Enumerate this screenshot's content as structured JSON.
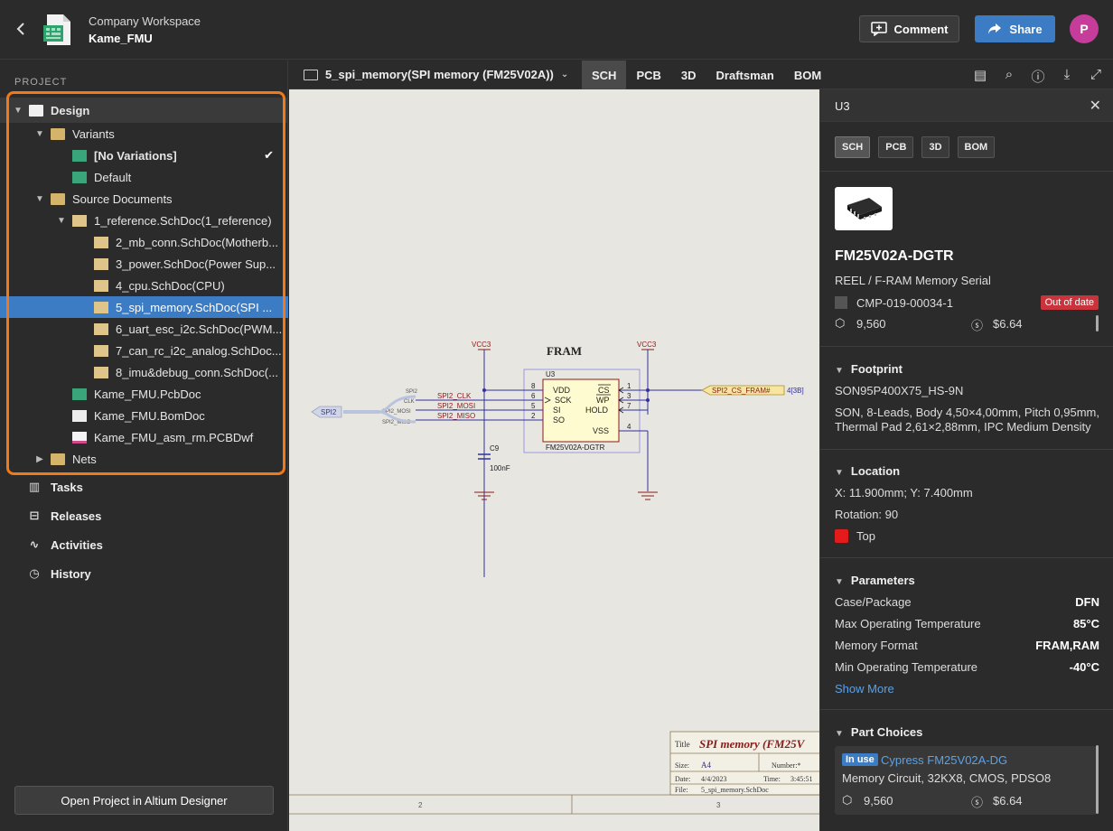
{
  "header": {
    "workspace": "Company Workspace",
    "project": "Kame_FMU",
    "comment_label": "Comment",
    "share_label": "Share",
    "avatar_initial": "P"
  },
  "sidebar": {
    "section_label": "PROJECT",
    "tree": {
      "design": "Design",
      "variants": "Variants",
      "no_variations": "[No Variations]",
      "default": "Default",
      "source_documents": "Source Documents",
      "ref_doc": "1_reference.SchDoc(1_reference)",
      "docs": [
        "2_mb_conn.SchDoc(Motherb...",
        "3_power.SchDoc(Power Sup...",
        "4_cpu.SchDoc(CPU)",
        "5_spi_memory.SchDoc(SPI ...",
        "6_uart_esc_i2c.SchDoc(PWM...",
        "7_can_rc_i2c_analog.SchDoc...",
        "8_imu&debug_conn.SchDoc(..."
      ],
      "pcbdoc": "Kame_FMU.PcbDoc",
      "bomdoc": "Kame_FMU.BomDoc",
      "pcbdwf": "Kame_FMU_asm_rm.PCBDwf",
      "nets": "Nets"
    },
    "nav": {
      "tasks": "Tasks",
      "releases": "Releases",
      "activities": "Activities",
      "history": "History"
    },
    "open_button": "Open Project in Altium Designer"
  },
  "docbar": {
    "document": "5_spi_memory(SPI memory (FM25V02A))",
    "tabs": [
      "SCH",
      "PCB",
      "3D",
      "Draftsman",
      "BOM"
    ],
    "active_tab": "SCH"
  },
  "schematic": {
    "block_title": "FRAM",
    "designator": "U3",
    "part": "FM25V02A-DGTR",
    "vcc_left": "VCC3",
    "vcc_right": "VCC3",
    "pins_left": [
      {
        "num": "8",
        "name": "VDD"
      },
      {
        "num": "6",
        "name": "SCK"
      },
      {
        "num": "5",
        "name": "SI"
      },
      {
        "num": "2",
        "name": "SO"
      }
    ],
    "pins_right": [
      {
        "num": "1",
        "name": "CS"
      },
      {
        "num": "3",
        "name": "WP"
      },
      {
        "num": "7",
        "name": "HOLD"
      },
      {
        "num": "4",
        "name": "VSS"
      }
    ],
    "nets_left": [
      "SPI2_CLK",
      "SPI2_MOSI",
      "SPI2_MISO"
    ],
    "bus_labels": [
      "SPI2",
      "CLK",
      "SPI2_MOSI",
      "SPI2_MISO"
    ],
    "bus_port": "SPI2",
    "cs_port": "SPI2_CS_FRAM#",
    "cs_ref": "4[3B]",
    "cap_name": "C9",
    "cap_value": "100nF",
    "title_block": {
      "title_label": "Title",
      "title_value": "SPI memory (FM25V",
      "size_label": "Size:",
      "size_value": "A4",
      "number_label": "Number:*",
      "date_label": "Date:",
      "date_value": "4/4/2023",
      "time_label": "Time:",
      "time_value": "3:45:51",
      "file_label": "File:",
      "file_value": "5_spi_memory.SchDoc"
    },
    "zones": [
      "2",
      "3"
    ]
  },
  "panel": {
    "title": "U3",
    "tabs": [
      "SCH",
      "PCB",
      "3D",
      "BOM"
    ],
    "part_number": "FM25V02A-DGTR",
    "description": "REEL / F-RAM Memory Serial",
    "cmp_id": "CMP-019-00034-1",
    "status_badge": "Out of date",
    "stock": "9,560",
    "price": "$6.64",
    "footprint": {
      "heading": "Footprint",
      "name": "SON95P400X75_HS-9N",
      "desc_line1": "SON, 8-Leads, Body 4,50×4,00mm, Pitch 0,95mm,",
      "desc_line2": "Thermal Pad 2,61×2,88mm, IPC Medium Density"
    },
    "location": {
      "heading": "Location",
      "xy": "X: 11.900mm; Y: 7.400mm",
      "rotation": "Rotation: 90",
      "layer": "Top"
    },
    "parameters": {
      "heading": "Parameters",
      "rows": [
        {
          "name": "Case/Package",
          "value": "DFN"
        },
        {
          "name": "Max Operating Temperature",
          "value": "85°C"
        },
        {
          "name": "Memory Format",
          "value": "FRAM,RAM"
        },
        {
          "name": "Min Operating Temperature",
          "value": "-40°C"
        }
      ],
      "show_more": "Show More"
    },
    "part_choices": {
      "heading": "Part Choices",
      "in_use": "In use",
      "name": "Cypress FM25V02A-DG",
      "desc": "Memory Circuit, 32KX8, CMOS, PDSO8",
      "stock": "9,560",
      "price": "$6.64"
    }
  },
  "colors": {
    "accent": "#3b7cc4",
    "highlight": "#f07a1a",
    "badge": "#c9343c",
    "layer_top": "#e31b1b"
  }
}
